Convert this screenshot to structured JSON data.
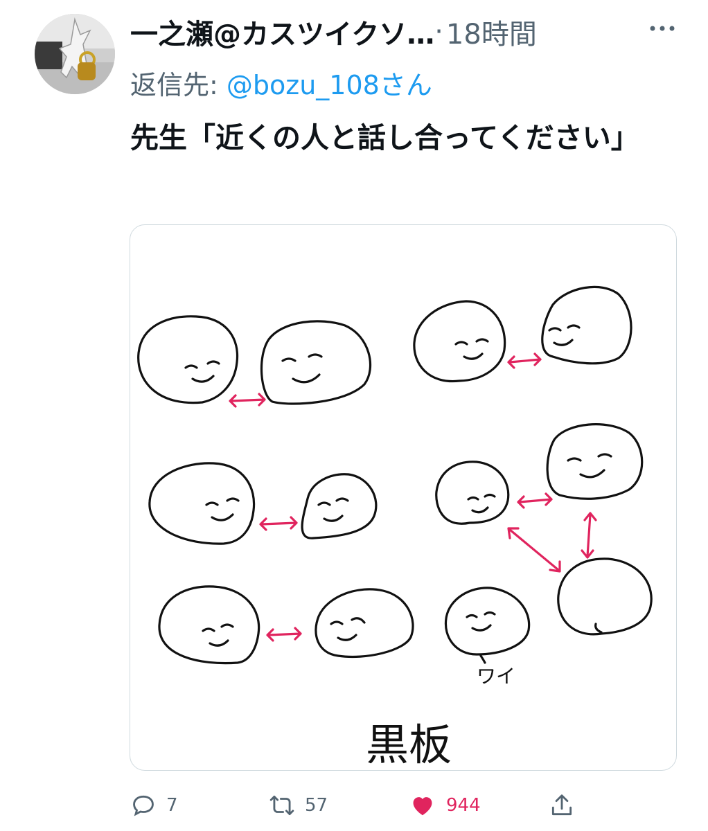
{
  "tweet": {
    "author_name": "一之瀬@カスツイクソ…",
    "separator": "·",
    "time": "18時間",
    "reply_prefix": "返信先: ",
    "reply_handle": "@bozu_108",
    "reply_suffix": "さん",
    "text": "先生「近くの人と話し合ってください」",
    "image_labels": {
      "me": "ワイ",
      "blackboard": "黒板"
    }
  },
  "actions": {
    "reply_count": "7",
    "retweet_count": "57",
    "like_count": "944",
    "liked": true
  },
  "icons": {
    "avatar": "avatar-figure",
    "more": "more-horizontal-icon",
    "reply": "reply-icon",
    "retweet": "retweet-icon",
    "like": "heart-icon",
    "share": "share-icon"
  },
  "colors": {
    "accent": "#1d9bf0",
    "like": "#e0245e",
    "arrow": "#e0245e",
    "secondary": "#536471"
  }
}
